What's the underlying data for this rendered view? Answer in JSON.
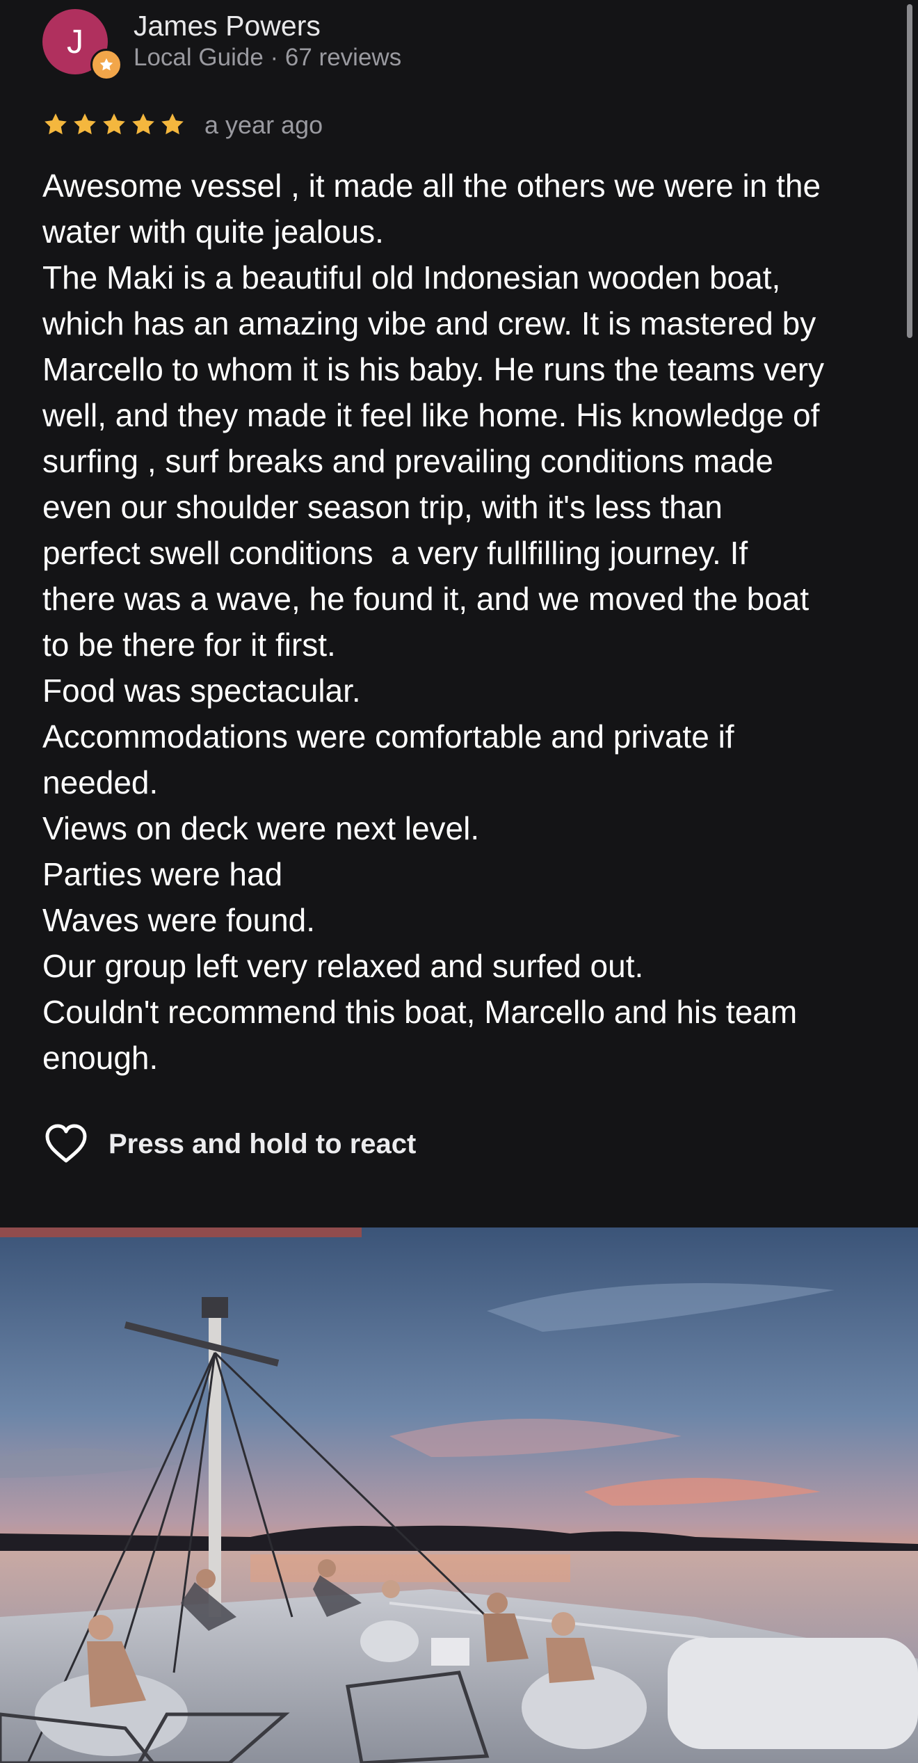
{
  "reviewer": {
    "initial": "J",
    "name": "James Powers",
    "meta": "Local Guide · 67 reviews",
    "avatar_color": "#b0305e",
    "badge_color": "#f2a64a",
    "badge_icon": "star-icon"
  },
  "rating": {
    "stars": 5,
    "max": 5,
    "star_color": "#f4b73e",
    "date": "a year ago"
  },
  "review": {
    "lines": [
      "Awesome vessel , it made all the others we were in the",
      "water with quite jealous.",
      "The Maki is a beautiful old Indonesian wooden boat,",
      "which has an amazing vibe and crew. It is mastered by",
      "Marcello to whom it is his baby. He runs the teams very",
      "well, and they made it feel like home. His knowledge of",
      "surfing , surf breaks and prevailing conditions made",
      "even our shoulder season trip, with it's less than",
      "perfect swell conditions  a very fullfilling journey. If",
      "there was a wave, he found it, and we moved the boat",
      "to be there for it first.",
      "Food was spectacular.",
      "Accommodations were comfortable and private if",
      "needed.",
      "Views on deck were next level.",
      "Parties were had",
      "Waves were found.",
      "Our group left very relaxed and surfed out.",
      "Couldn't recommend this boat, Marcello and his team",
      "enough."
    ]
  },
  "reaction": {
    "icon": "heart-icon",
    "label": "Press and hold to react"
  },
  "photo": {
    "subject": "review-photo"
  },
  "colors": {
    "background": "#141416",
    "text_primary": "#ffffff",
    "text_secondary": "#9a9aa0"
  }
}
